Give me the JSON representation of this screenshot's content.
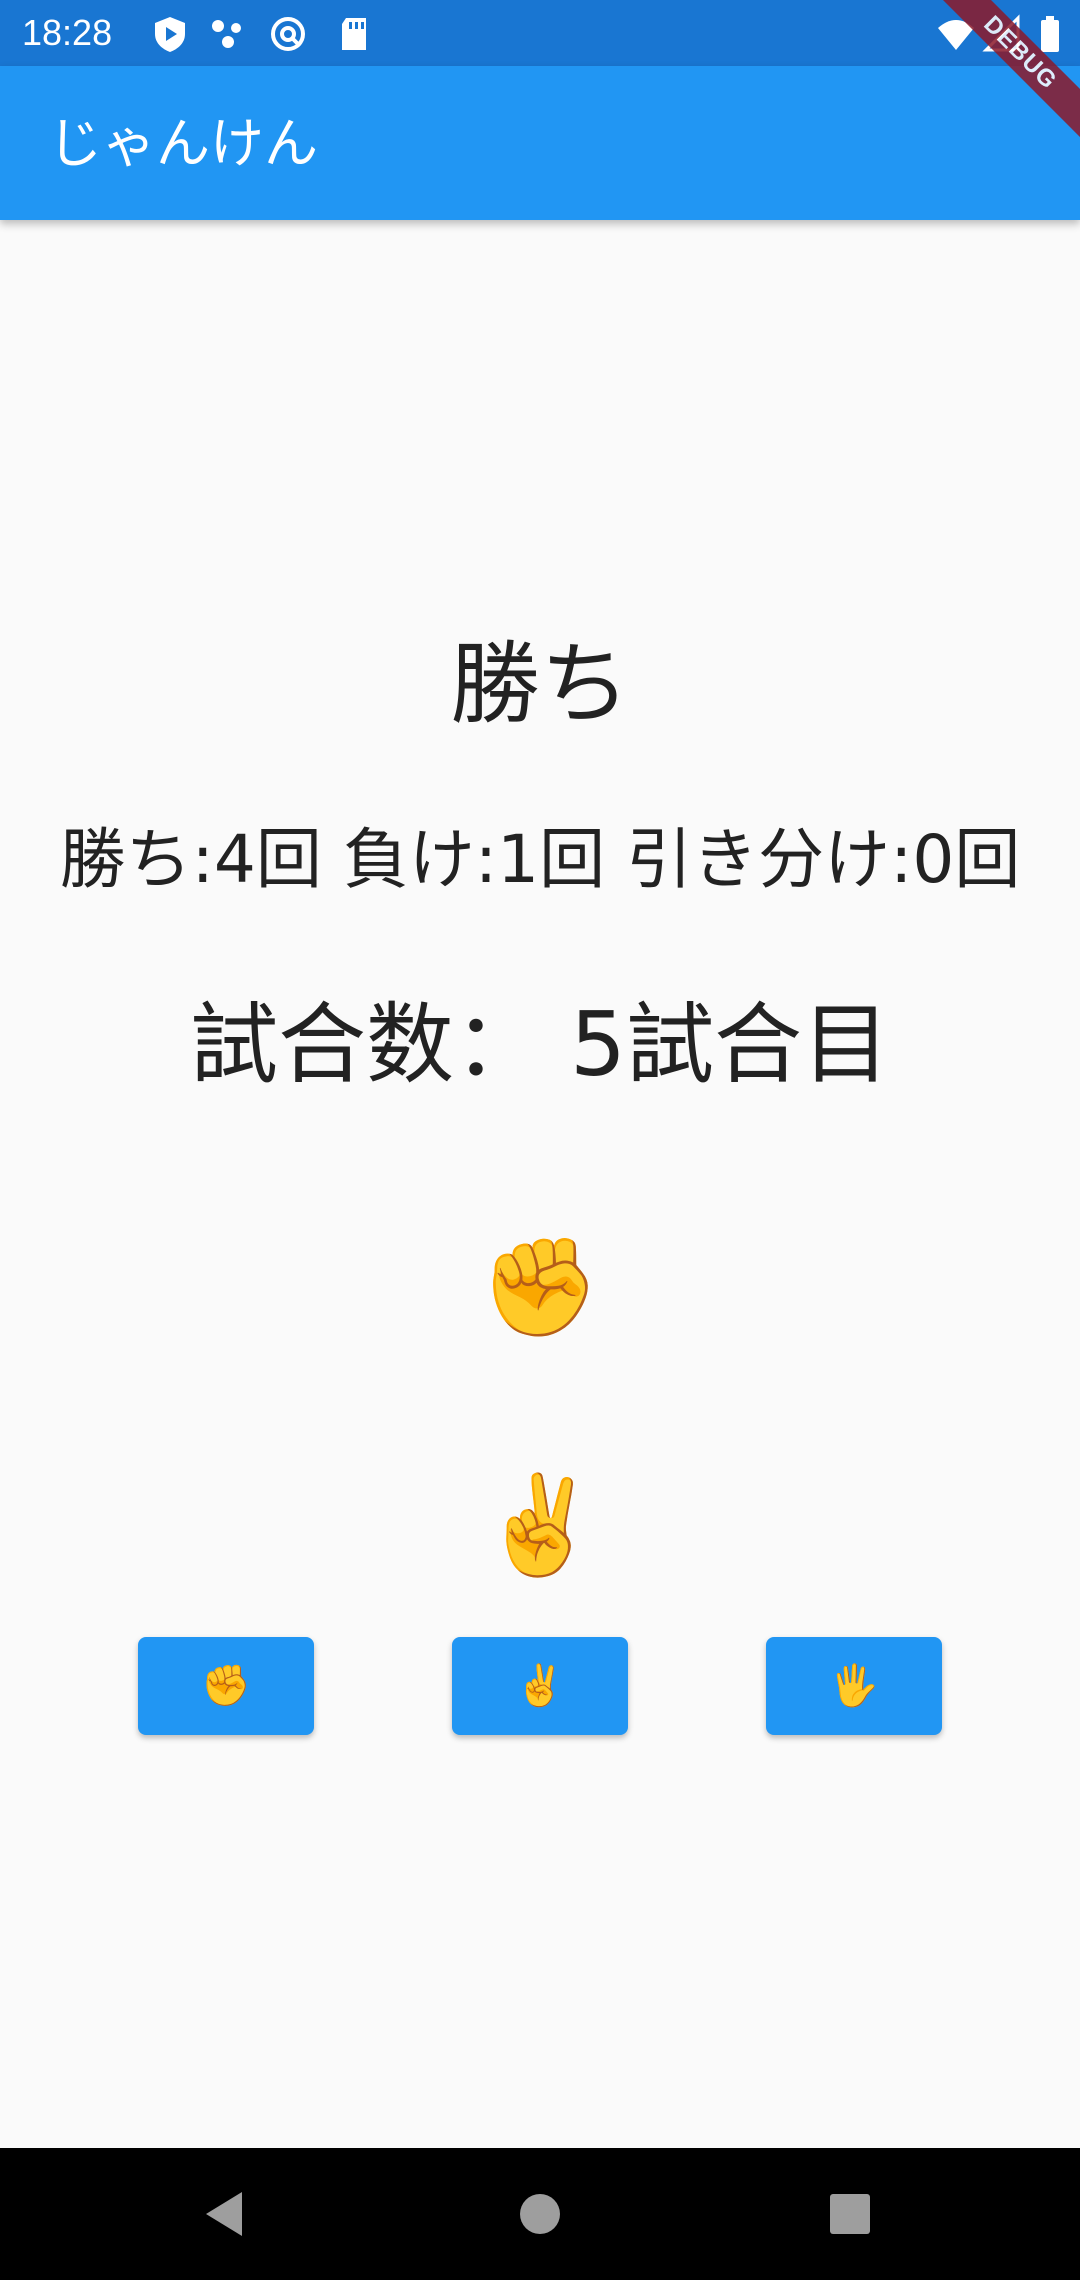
{
  "status_bar": {
    "time": "18:28",
    "color": "#1976d2"
  },
  "app_bar": {
    "title": "じゃんけん",
    "color": "#2196f3"
  },
  "debug_banner": "DEBUG",
  "game": {
    "result": "勝ち",
    "record": "勝ち:4回 負け:1回 引き分け:0回",
    "match_count": "試合数：  5試合目",
    "computer_hand": "✊",
    "player_hand": "✌️"
  },
  "buttons": {
    "rock": "✊",
    "scissors": "✌️",
    "paper": "🖐️"
  },
  "nav": {
    "back": "back-icon",
    "home": "home-icon",
    "recents": "recents-icon"
  }
}
